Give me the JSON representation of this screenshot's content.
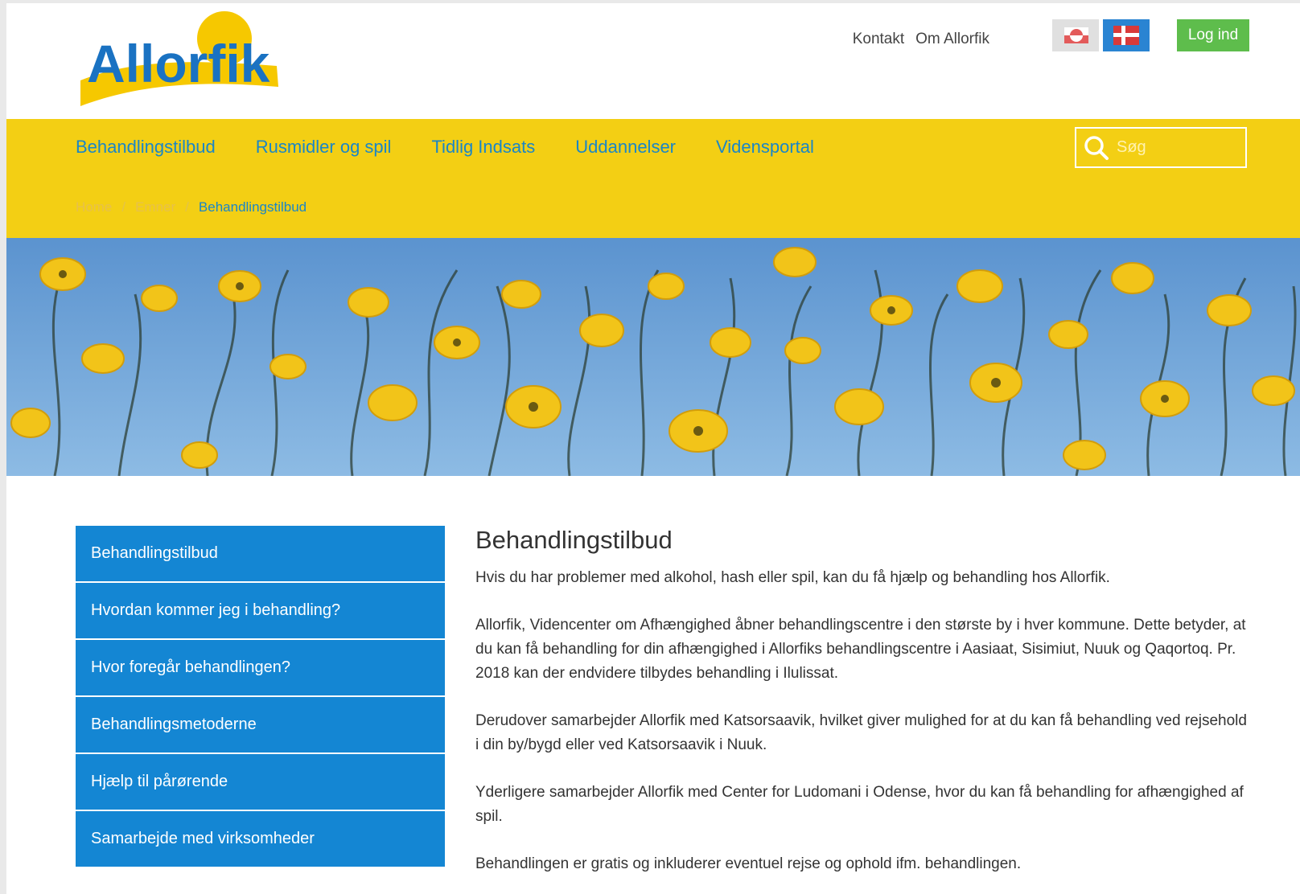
{
  "header": {
    "logo_text": "Allorfik",
    "links": [
      "Kontakt",
      "Om Allorfik"
    ],
    "login_label": "Log ind"
  },
  "nav": {
    "items": [
      "Behandlingstilbud",
      "Rusmidler og spil",
      "Tidlig Indsats",
      "Uddannelser",
      "Vidensportal"
    ],
    "search_placeholder": "Søg"
  },
  "breadcrumb": {
    "items": [
      "Home",
      "Emner"
    ],
    "separator": "/",
    "current": "Behandlingstilbud"
  },
  "sidebar": {
    "items": [
      "Behandlingstilbud",
      "Hvordan kommer jeg i behandling?",
      "Hvor foregår behandlingen?",
      "Behandlingsmetoderne",
      "Hjælp til pårørende",
      "Samarbejde med virksomheder"
    ]
  },
  "content": {
    "title": "Behandlingstilbud",
    "paragraphs": [
      "Hvis du har problemer med alkohol, hash eller spil, kan du få hjælp og behandling hos Allorfik.",
      "Allorfik, Videncenter om Afhængighed åbner behandlingscentre i den største by i hver kommune. Dette betyder, at du kan få behandling for din afhængighed i Allorfiks behandlingscentre i Aasiaat, Sisimiut, Nuuk og Qaqortoq. Pr. 2018 kan der endvidere tilbydes behandling i Ilulissat.",
      "Derudover samarbejder Allorfik med Katsorsaavik, hvilket giver mulighed for at du kan få behandling ved rejsehold i din by/bygd eller ved Katsorsaavik i Nuuk.",
      "Yderligere samarbejder Allorfik med Center for Ludomani i Odense, hvor du kan få behandling for afhængighed af spil.",
      "Behandlingen er gratis og inkluderer eventuel rejse og ophold ifm. behandlingen."
    ]
  },
  "colors": {
    "yellow_band": "#f3cf14",
    "nav_blue": "#1a86c7",
    "sidebar_blue": "#1486d3",
    "login_green": "#5ebd4c"
  },
  "icons": {
    "search": "search-icon",
    "flag_greenland": "greenland-flag-icon",
    "flag_denmark": "denmark-flag-icon"
  }
}
